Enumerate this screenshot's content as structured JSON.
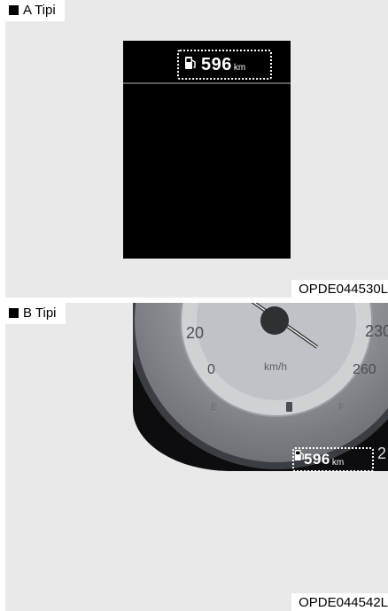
{
  "section_a": {
    "label": "A Tipi",
    "range_value": "596",
    "range_unit": "km",
    "figure_code": "OPDE044530L"
  },
  "section_b": {
    "label": "B Tipi",
    "range_value": "596",
    "range_unit": "km",
    "figure_code": "OPDE044542L",
    "gauge": {
      "speed_labels": [
        "20",
        "0",
        "230",
        "260"
      ],
      "unit": "km/h",
      "fuel_empty": "E",
      "fuel_full": "F",
      "edge_digit": "2"
    }
  },
  "colors": {
    "panel": "#e9e9e9",
    "display": "#000000",
    "highlight": "#ffffff"
  },
  "icons": {
    "fuel": "fuel-pump-icon"
  }
}
